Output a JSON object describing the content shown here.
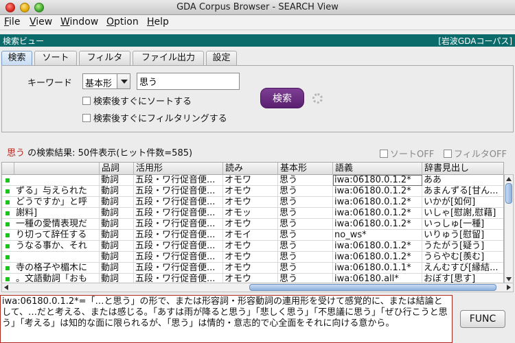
{
  "window": {
    "title": "GDA Corpus Browser - SEARCH View"
  },
  "menubar": {
    "items": [
      {
        "label": "File",
        "mnemonic": "F",
        "rest": "ile"
      },
      {
        "label": "View",
        "mnemonic": "V",
        "rest": "iew"
      },
      {
        "label": "Window",
        "mnemonic": "W",
        "rest": "indow"
      },
      {
        "label": "Option",
        "mnemonic": "O",
        "rest": "ption"
      },
      {
        "label": "Help",
        "mnemonic": "H",
        "rest": "elp"
      }
    ]
  },
  "viewbar": {
    "left": "検索ビュー",
    "right": "[岩波GDAコーパス]"
  },
  "tabs": [
    "検索",
    "ソート",
    "フィルタ",
    "ファイル出力",
    "設定"
  ],
  "search": {
    "keyword_label": "キーワード",
    "mode_value": "基本形",
    "keyword_value": "思う",
    "sort_after": "検索後すぐにソートする",
    "filter_after": "検索後すぐにフィルタリングする",
    "button_label": "検索"
  },
  "results": {
    "keyword": "思う",
    "summary": " の検索結果: 50件表示(ヒット件数=585)",
    "sort_off": "ソートOFF",
    "filter_off": "フィルタOFF"
  },
  "table": {
    "columns": [
      "",
      "",
      "品詞",
      "活用形",
      "読み",
      "基本形",
      "語義",
      "辞書見出し"
    ],
    "rows": [
      [
        "",
        "動詞",
        "五段・ワ行促音便...",
        "オモワ",
        "思う",
        "iwa:06180.0.1.2*",
        "ああ"
      ],
      [
        "ずる」与えられた",
        "動詞",
        "五段・ワ行促音便...",
        "オモウ",
        "思う",
        "iwa:06180.0.1.2*",
        "あまんずる[甘ん..."
      ],
      [
        "どうですか」と呼",
        "動詞",
        "五段・ワ行促音便...",
        "オモウ",
        "思う",
        "iwa:06180.0.1.2*",
        "いかが[如何]"
      ],
      [
        "謝料]",
        "動詞",
        "五段・ワ行促音便...",
        "オモッ",
        "思う",
        "iwa:06180.0.1.2*",
        "いしゃ[慰謝,慰藉]"
      ],
      [
        "一種の愛情表現だ",
        "動詞",
        "五段・ワ行促音便...",
        "オモウ",
        "思う",
        "iwa:06180.0.1.2*",
        "いっしゅ[一種]"
      ],
      [
        "り切って辞任する",
        "動詞",
        "五段・ワ行促音便...",
        "オモイ",
        "思う",
        "no_ws*",
        "いりゅう[慰留]"
      ],
      [
        "うなる事か、それ",
        "動詞",
        "五段・ワ行促音便...",
        "オモウ",
        "思う",
        "iwa:06180.0.1.2*",
        "うたがう[疑う]"
      ],
      [
        "",
        "動詞",
        "五段・ワ行促音便...",
        "オモウ",
        "思う",
        "iwa:06180.0.1.2*",
        "うらやむ[羨む]"
      ],
      [
        "寺の格子や楣木に",
        "動詞",
        "五段・ワ行促音便...",
        "オモウ",
        "思う",
        "iwa:06180.0.1.1*",
        "えんむすび[縁結..."
      ],
      [
        "。文語動詞「おも",
        "動詞",
        "五段・ワ行促音便...",
        "オモウ",
        "思う",
        "iwa:06180.all*",
        "おぼす[思す]"
      ]
    ]
  },
  "description": "iwa:06180.0.1.2*=「…と思う」の形で、または形容詞・形容動詞の連用形を受けて感覚的に、または結論として、…だと考える、または感じる。「あすは雨が降ると思う」「悲しく思う」「不思議に思う」「ぜひ行こうと思う」「考える」は知的な面に限られるが、「思う」は情的・意志的で心全面をそれに向ける意から。",
  "func_button": "FUNC"
}
